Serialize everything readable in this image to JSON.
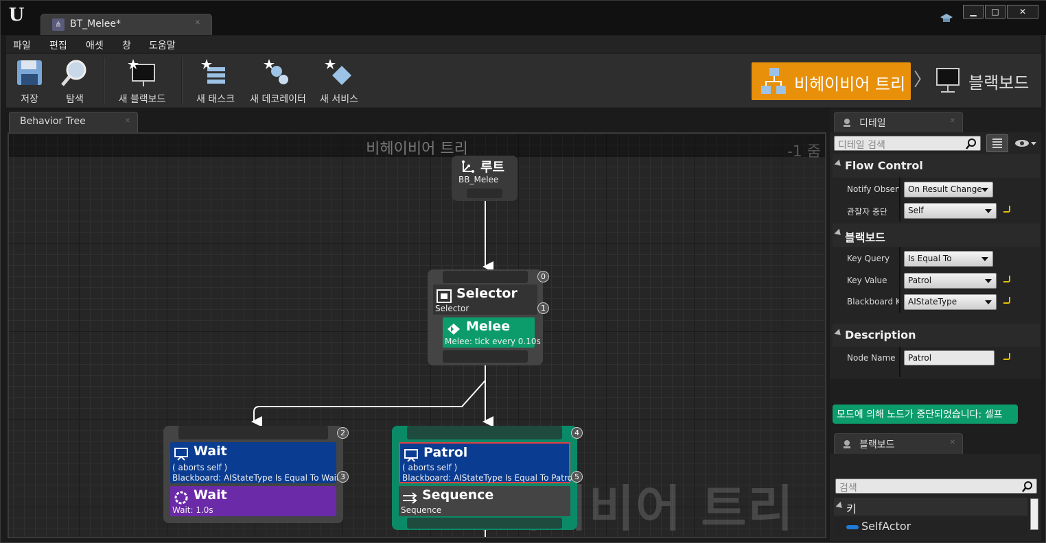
{
  "window": {
    "doc_tab": "BT_Melee*",
    "minimize": "▁",
    "maximize": "□",
    "close": "✕"
  },
  "menu": [
    "파일",
    "편집",
    "애셋",
    "창",
    "도움말"
  ],
  "toolbar": {
    "save": "저장",
    "browse": "탐색",
    "new_blackboard": "새 블랙보드",
    "new_task": "새 태스크",
    "new_decorator": "새 데코레이터",
    "new_service": "새 서비스"
  },
  "modes": {
    "behavior_tree": "비헤이비어 트리",
    "blackboard": "블랙보드"
  },
  "graph": {
    "tab": "Behavior Tree",
    "title": "비헤이비어 트리",
    "zoom": "-1 줌",
    "watermark": "비헤이비어 트리",
    "root": {
      "title": "루트",
      "sub": "BB_Melee"
    },
    "selector": {
      "title": "Selector",
      "sub": "Selector",
      "idx": "0",
      "svc_idx": "1"
    },
    "melee": {
      "title": "Melee",
      "sub": "Melee: tick every 0.10s"
    },
    "wait_dec": {
      "title": "Wait",
      "line1": "( aborts self )",
      "line2": "Blackboard: AIStateType Is Equal To Wait",
      "idx": "2",
      "dec_idx": "3"
    },
    "wait_task": {
      "title": "Wait",
      "sub": "Wait: 1.0s"
    },
    "patrol_dec": {
      "title": "Patrol",
      "line1": "( aborts self )",
      "line2": "Blackboard: AIStateType Is Equal To Patrol",
      "idx": "4",
      "dec_idx": "5"
    },
    "sequence": {
      "title": "Sequence",
      "sub": "Sequence"
    }
  },
  "details": {
    "tab": "디테일",
    "search_placeholder": "디테일 검색",
    "flow_control": {
      "header": "Flow Control",
      "notify_label": "Notify Observ",
      "notify_value": "On Result Change",
      "abort_label": "관찰자 중단",
      "abort_value": "Self"
    },
    "blackboard": {
      "header": "블랙보드",
      "key_query_label": "Key Query",
      "key_query_value": "Is Equal To",
      "key_value_label": "Key Value",
      "key_value_value": "Patrol",
      "bb_key_label": "Blackboard K",
      "bb_key_value": "AIStateType"
    },
    "description": {
      "header": "Description",
      "node_name_label": "Node Name",
      "node_name_value": "Patrol"
    },
    "notice": "모드에 의해 노드가 중단되었습니다: 셀프"
  },
  "blackboard_panel": {
    "tab": "블랙보드",
    "search_placeholder": "검색",
    "keys_header": "키",
    "keys": [
      "SelfActor"
    ]
  },
  "colors": {
    "accent": "#e8900a",
    "decorator_blue": "#0a3c91",
    "service_green": "#0c9c6c",
    "task_purple": "#6b2aa7",
    "active_node": "#0b8a68"
  }
}
